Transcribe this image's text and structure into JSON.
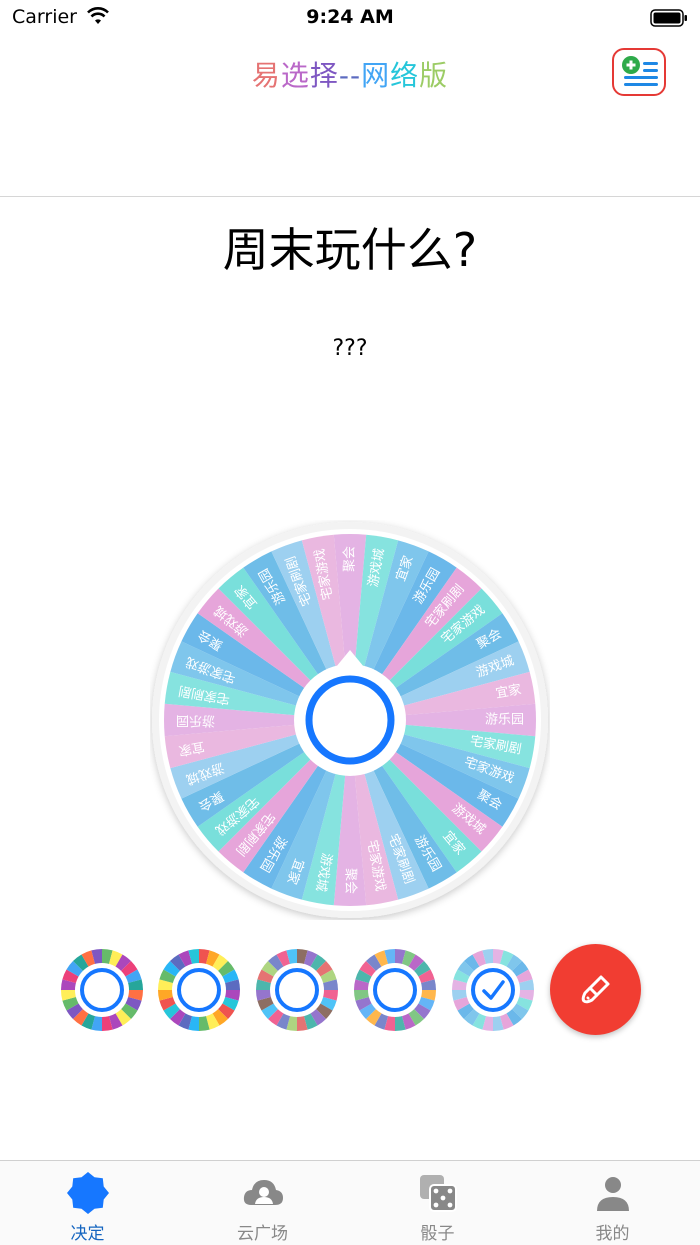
{
  "status_bar": {
    "carrier": "Carrier",
    "time": "9:24 AM"
  },
  "header": {
    "title_parts": [
      {
        "text": "易",
        "color": "#e57373"
      },
      {
        "text": "选",
        "color": "#ba68c8"
      },
      {
        "text": "择",
        "color": "#7e57c2"
      },
      {
        "text": "--",
        "color": "#5c6bc0"
      },
      {
        "text": "网",
        "color": "#42a5f5"
      },
      {
        "text": "络",
        "color": "#26c6da"
      },
      {
        "text": "版",
        "color": "#9ccc65"
      }
    ],
    "add_list_icon": "add-list-icon"
  },
  "main": {
    "question": "周末玩什么?",
    "result": "???"
  },
  "wheel": {
    "options": [
      "聚会",
      "游戏城",
      "宜家",
      "游乐园",
      "宅家刷剧",
      "宅家游戏"
    ],
    "repeat": 6,
    "colors": [
      "#e4b3e4",
      "#86e3df",
      "#7fc6ec",
      "#6bb8ea",
      "#e6a5da",
      "#79dfdb",
      "#6fbde8",
      "#9dd0f0",
      "#eab8e0"
    ],
    "center_color": "#1677ff"
  },
  "themes": [
    {
      "colors": [
        "#66bb6a",
        "#ffee58",
        "#ab47bc",
        "#ec407a",
        "#42a5f5",
        "#26a69a",
        "#ff7043",
        "#7e57c2"
      ],
      "selected": false
    },
    {
      "colors": [
        "#ef5350",
        "#ffa726",
        "#ffee58",
        "#66bb6a",
        "#29b6f6",
        "#5c6bc0",
        "#ab47bc",
        "#26c6da"
      ],
      "selected": false
    },
    {
      "colors": [
        "#8d6e63",
        "#9575cd",
        "#4db6ac",
        "#e57373",
        "#aed581",
        "#7986cb",
        "#f06292",
        "#4fc3f7"
      ],
      "selected": false
    },
    {
      "colors": [
        "#9575cd",
        "#81c784",
        "#ba68c8",
        "#4db6ac",
        "#f06292",
        "#7986cb",
        "#ffb74d",
        "#64b5f6"
      ],
      "selected": false
    },
    {
      "colors": [
        "#e4b3e4",
        "#86e3df",
        "#7fc6ec",
        "#6bb8ea",
        "#e6a5da",
        "#9dd0f0"
      ],
      "selected": true
    }
  ],
  "tabs": [
    {
      "label": "决定",
      "icon": "badge-icon",
      "active": true
    },
    {
      "label": "云广场",
      "icon": "cloud-user-icon",
      "active": false
    },
    {
      "label": "骰子",
      "icon": "dice-icon",
      "active": false
    },
    {
      "label": "我的",
      "icon": "person-icon",
      "active": false
    }
  ],
  "colors": {
    "accent": "#1677ff",
    "brush_button": "#f13d32",
    "tab_active": "#1565c0",
    "tab_inactive": "#888888"
  }
}
